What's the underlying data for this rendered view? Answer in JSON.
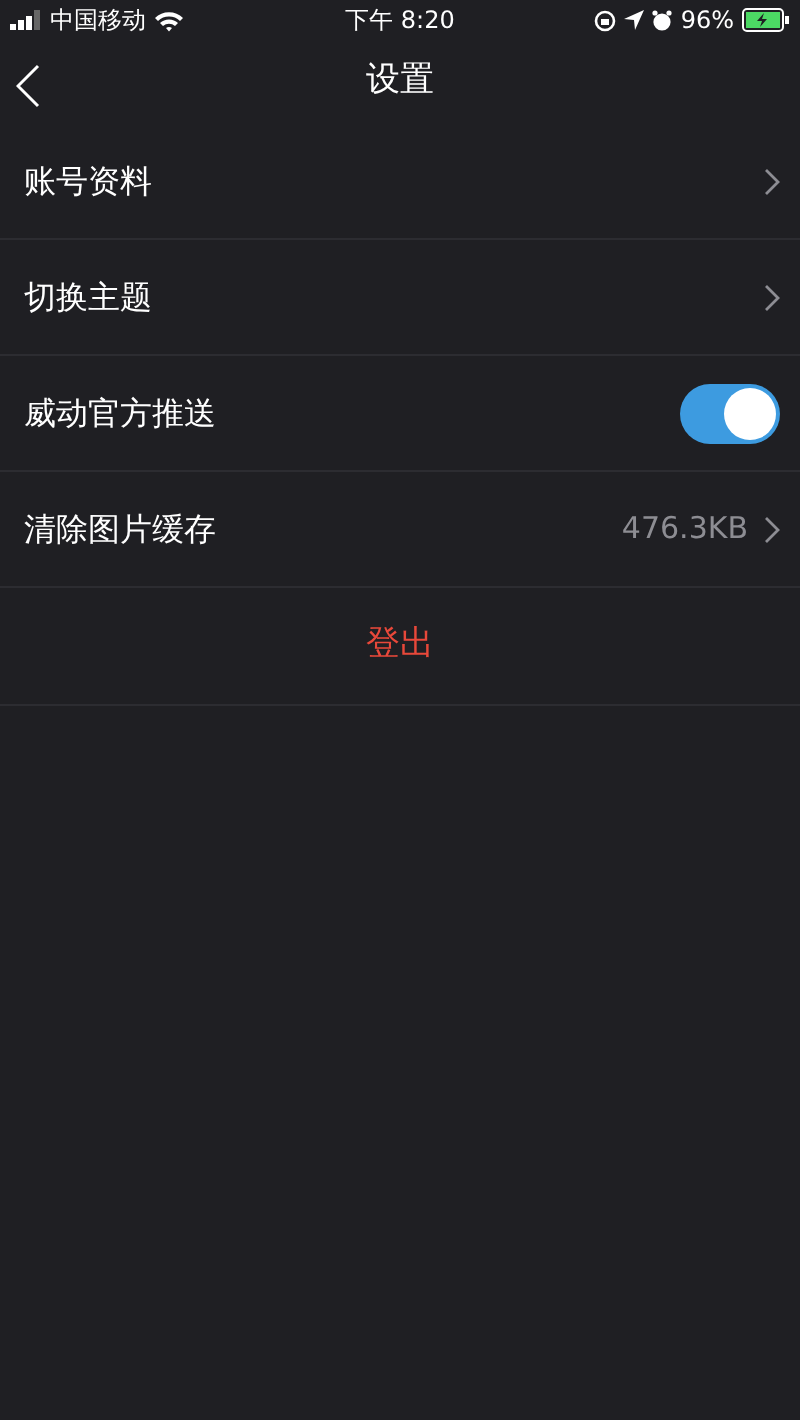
{
  "status_bar": {
    "carrier": "中国移动",
    "time": "下午 8:20",
    "battery": "96%"
  },
  "nav": {
    "title": "设置"
  },
  "settings": [
    {
      "kind": "link",
      "label": "账号资料"
    },
    {
      "kind": "link",
      "label": "切换主题"
    },
    {
      "kind": "toggle",
      "label": "威动官方推送",
      "on": true
    },
    {
      "kind": "value",
      "label": "清除图片缓存",
      "value": "476.3KB"
    }
  ],
  "logout": {
    "label": "登出"
  }
}
